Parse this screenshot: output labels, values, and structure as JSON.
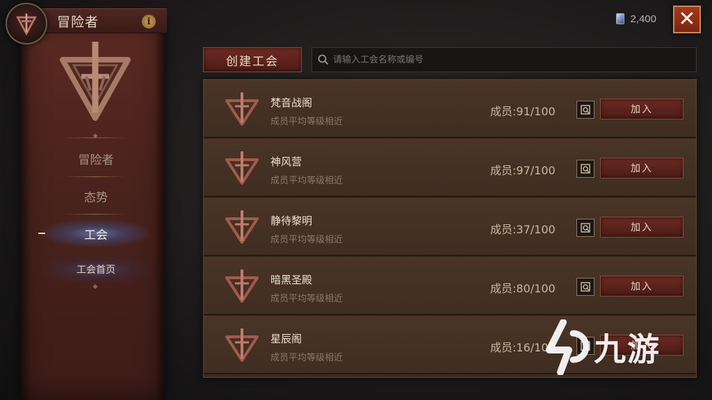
{
  "header": {
    "title": "冒险者",
    "info_label": "i"
  },
  "currency": {
    "amount": "2,400",
    "icon": "gem-icon"
  },
  "close_label": "✕",
  "sidebar": {
    "items": [
      {
        "label": "冒险者",
        "active": false
      },
      {
        "label": "态势",
        "active": false
      },
      {
        "label": "工会",
        "active": true
      },
      {
        "label": "工会首页",
        "active": false
      }
    ]
  },
  "toolbar": {
    "create_label": "创建工会",
    "search_placeholder": "请输入工会名称或编号",
    "search_value": ""
  },
  "guilds": [
    {
      "name": "梵音战阁",
      "desc": "成员平均等级相近",
      "members": "成员:91/100",
      "join_label": "加入"
    },
    {
      "name": "神风营",
      "desc": "成员平均等级相近",
      "members": "成员:97/100",
      "join_label": "加入"
    },
    {
      "name": "静待黎明",
      "desc": "成员平均等级相近",
      "members": "成员:37/100",
      "join_label": "加入"
    },
    {
      "name": "暗黑圣殿",
      "desc": "成员平均等级相近",
      "members": "成员:80/100",
      "join_label": "加入"
    },
    {
      "name": "星辰阁",
      "desc": "成员平均等级相近",
      "members": "成员:16/100",
      "join_label": "加入"
    }
  ],
  "watermark": {
    "text": "九游"
  },
  "colors": {
    "banner": "#4c231d",
    "accent_button": "#6a2a22",
    "row_bg": "#4a3526",
    "active_glow": "#78aaff"
  }
}
